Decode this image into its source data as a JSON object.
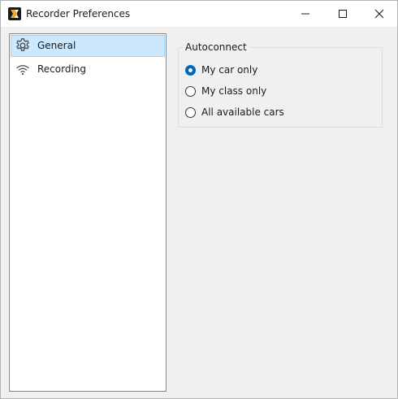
{
  "window": {
    "title": "Recorder Preferences",
    "icon": "recorder-app-icon",
    "controls": {
      "minimize_icon": "minimize-icon",
      "maximize_icon": "maximize-icon",
      "close_icon": "close-icon"
    }
  },
  "sidebar": {
    "items": [
      {
        "label": "General",
        "icon": "gear-icon",
        "selected": true
      },
      {
        "label": "Recording",
        "icon": "wifi-icon",
        "selected": false
      }
    ]
  },
  "autoconnect": {
    "title": "Autoconnect",
    "options": [
      {
        "label": "My car only",
        "checked": true
      },
      {
        "label": "My class only",
        "checked": false
      },
      {
        "label": "All available cars",
        "checked": false
      }
    ]
  },
  "colors": {
    "accent": "#0067c0",
    "selection_bg": "#cce8ff",
    "selection_border": "#99d1ff"
  }
}
